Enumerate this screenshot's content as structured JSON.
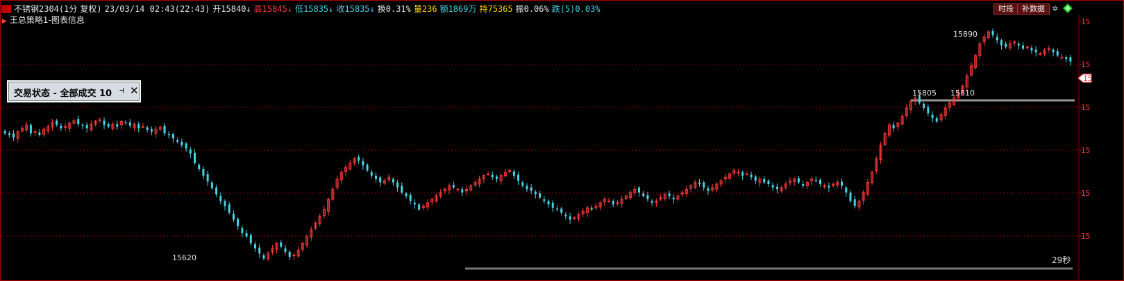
{
  "header": {
    "symbol": "不锈钢2304(1分",
    "adjust": "复权)",
    "datetime": "23/03/14 02:43(22:43)",
    "open": "开15840↓",
    "high": "高15845↓",
    "low": "低15835↓",
    "close": "收15835↓",
    "turnover": "换0.31%",
    "volume": "量236",
    "amount": "额1869万",
    "position": "持75365",
    "amplitude": "振0.06%",
    "change": "跌(5)0.03%"
  },
  "strategy_label": "王总策略1-图表信息",
  "toolbar": {
    "time_split": "时段",
    "fill_data": "补数据"
  },
  "status_box": {
    "title": "交易状态 - 全部成交 10",
    "pin": "⊣",
    "close": "✕"
  },
  "seconds_label": "29秒",
  "annotations": {
    "high_label": "15890",
    "low_label": "15620",
    "level1": "15805",
    "level2": "15810"
  },
  "axis_tick_prefix": "15",
  "current_price_label": "15",
  "colors": {
    "background": "#000000",
    "up": "#ff3b3b",
    "down": "#45d5e6",
    "grid": "#8b0000",
    "level_line": "#999999"
  },
  "chart_data": {
    "type": "candlestick",
    "y_ticks_display": [
      "15",
      "15",
      "15",
      "15",
      "15",
      "15"
    ],
    "ylim": [
      15610,
      15900
    ],
    "high": 15890,
    "low": 15620,
    "marked_levels": [
      15805,
      15810
    ],
    "close_series": [
      15770,
      15768,
      15765,
      15772,
      15776,
      15780,
      15770,
      15772,
      15768,
      15775,
      15778,
      15783,
      15780,
      15776,
      15778,
      15782,
      15785,
      15781,
      15779,
      15776,
      15781,
      15784,
      15786,
      15780,
      15778,
      15781,
      15778,
      15784,
      15782,
      15779,
      15781,
      15776,
      15778,
      15774,
      15772,
      15775,
      15777,
      15770,
      15768,
      15764,
      15760,
      15756,
      15752,
      15746,
      15735,
      15728,
      15720,
      15713,
      15705,
      15698,
      15690,
      15684,
      15676,
      15668,
      15660,
      15652,
      15648,
      15640,
      15634,
      15628,
      15622,
      15628,
      15634,
      15640,
      15636,
      15630,
      15624,
      15626,
      15632,
      15640,
      15648,
      15656,
      15664,
      15672,
      15680,
      15692,
      15704,
      15716,
      15724,
      15730,
      15735,
      15740,
      15738,
      15732,
      15726,
      15720,
      15716,
      15712,
      15714,
      15718,
      15712,
      15706,
      15700,
      15696,
      15690,
      15686,
      15680,
      15684,
      15688,
      15692,
      15696,
      15700,
      15704,
      15708,
      15706,
      15704,
      15700,
      15704,
      15708,
      15712,
      15716,
      15720,
      15722,
      15718,
      15716,
      15720,
      15724,
      15726,
      15720,
      15714,
      15708,
      15704,
      15702,
      15698,
      15694,
      15690,
      15686,
      15682,
      15680,
      15676,
      15672,
      15668,
      15670,
      15674,
      15678,
      15682,
      15680,
      15684,
      15688,
      15692,
      15690,
      15686,
      15688,
      15692,
      15696,
      15700,
      15704,
      15700,
      15696,
      15692,
      15688,
      15690,
      15694,
      15698,
      15696,
      15692,
      15696,
      15700,
      15704,
      15708,
      15712,
      15710,
      15706,
      15702,
      15706,
      15710,
      15714,
      15718,
      15722,
      15726,
      15724,
      15720,
      15722,
      15718,
      15714,
      15716,
      15712,
      15710,
      15706,
      15704,
      15706,
      15710,
      15714,
      15716,
      15712,
      15708,
      15712,
      15716,
      15714,
      15710,
      15708,
      15706,
      15710,
      15712,
      15708,
      15700,
      15690,
      15684,
      15690,
      15700,
      15712,
      15724,
      15740,
      15756,
      15770,
      15780,
      15776,
      15782,
      15790,
      15800,
      15808,
      15812,
      15806,
      15800,
      15794,
      15788,
      15784,
      15792,
      15800,
      15806,
      15812,
      15818,
      15826,
      15838,
      15850,
      15862,
      15876,
      15884,
      15890,
      15886,
      15880,
      15874,
      15872,
      15876,
      15878,
      15874,
      15870,
      15872,
      15868,
      15866,
      15864,
      15868,
      15870,
      15866,
      15862,
      15860,
      15858,
      15855
    ]
  }
}
